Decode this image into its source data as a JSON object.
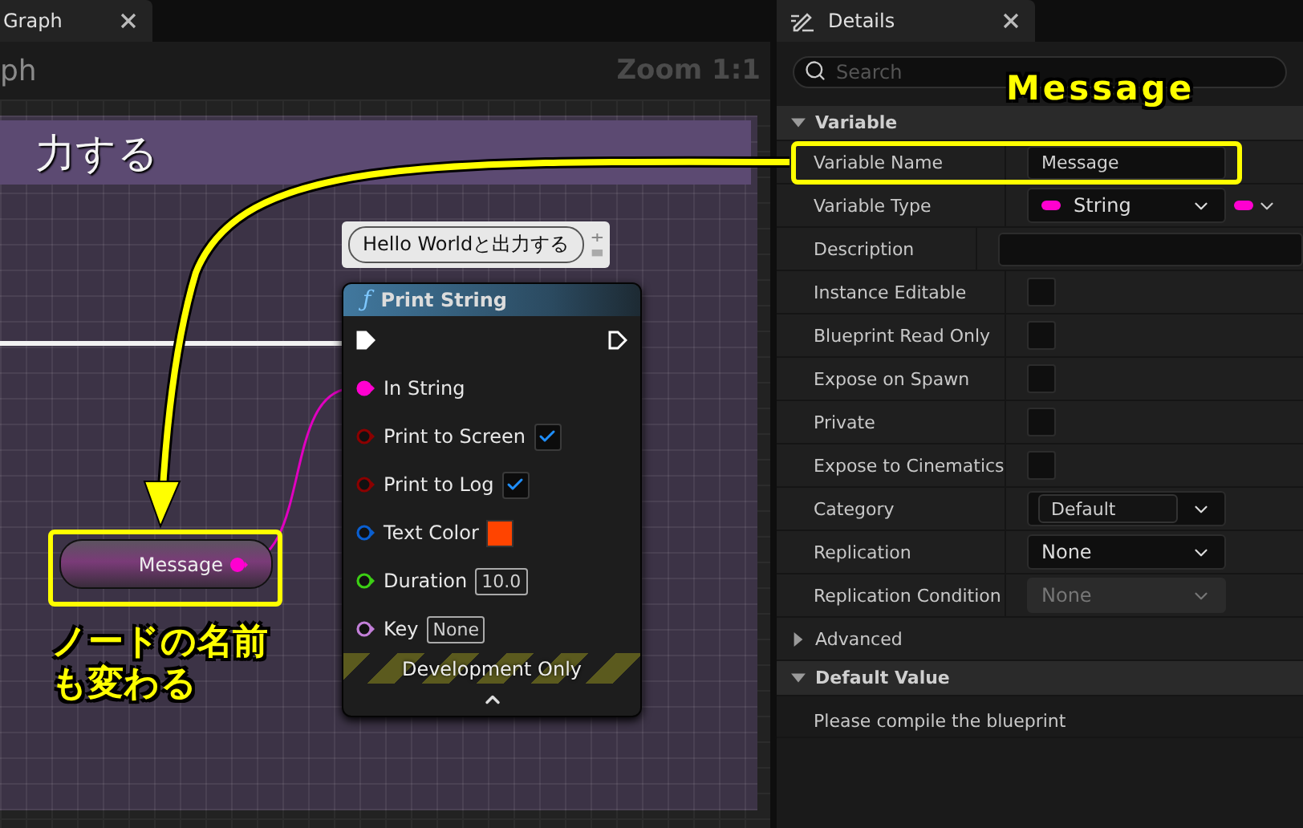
{
  "graph": {
    "tab": {
      "title": "Graph"
    },
    "header_title": "ph",
    "zoom": "Zoom 1:1",
    "comment": {
      "title": "力する"
    },
    "print_node": {
      "icon": "ƒ",
      "title": "Print String",
      "comment": "Hello Worldと出力する",
      "pins": [
        {
          "kind": "exec",
          "connected": true,
          "out_connected": false
        },
        {
          "kind": "string",
          "label": "In String",
          "color": "#ff00d0",
          "connected": true
        },
        {
          "kind": "bool",
          "label": "Print to Screen",
          "color": "#8b0000",
          "connected": false,
          "checked": true
        },
        {
          "kind": "bool",
          "label": "Print to Log",
          "color": "#8b0000",
          "connected": false,
          "checked": true
        },
        {
          "kind": "color",
          "label": "Text Color",
          "color": "#0a5fd0",
          "connected": false,
          "swatch": {
            "color": "#ff4400"
          }
        },
        {
          "kind": "value",
          "label": "Duration",
          "color": "#3ccf14",
          "connected": false,
          "value": "10.0"
        },
        {
          "kind": "value",
          "label": "Key",
          "color": "#c27fd8",
          "connected": false,
          "value": "None"
        }
      ],
      "footer": "Development Only"
    },
    "variable_node": {
      "name": "Message",
      "highlighted": true
    },
    "annotation": [
      "ノードの名前",
      "も変わる"
    ]
  },
  "details": {
    "tab": {
      "title": "Details"
    },
    "search": {
      "placeholder": "Search"
    },
    "annotation": "Message",
    "sections": [
      {
        "kind": "category",
        "title": "Variable",
        "expanded": true,
        "rows": [
          {
            "kind": "text",
            "label": "Variable Name",
            "value": "Message",
            "highlighted": true
          },
          {
            "kind": "type",
            "label": "Variable Type",
            "value": "String",
            "color": "#ff00d0"
          },
          {
            "kind": "text",
            "label": "Description",
            "highlighted": false
          },
          {
            "kind": "checkbox",
            "label": "Instance Editable",
            "checked": false
          },
          {
            "kind": "checkbox",
            "label": "Blueprint Read Only",
            "checked": false
          },
          {
            "kind": "checkbox",
            "label": "Expose on Spawn",
            "checked": false
          },
          {
            "kind": "checkbox",
            "label": "Private",
            "checked": false
          },
          {
            "kind": "checkbox",
            "label": "Expose to Cinematics",
            "checked": false
          },
          {
            "kind": "category_combo",
            "label": "Category",
            "value": "Default"
          },
          {
            "kind": "combo",
            "label": "Replication",
            "value": "None",
            "disabled": false
          },
          {
            "kind": "combo",
            "label": "Replication Condition",
            "value": "None",
            "disabled": true
          }
        ]
      },
      {
        "kind": "subcategory",
        "title": "Advanced",
        "expanded": false
      },
      {
        "kind": "category",
        "title": "Default Value",
        "expanded": true,
        "message": "Please compile the blueprint"
      }
    ]
  }
}
